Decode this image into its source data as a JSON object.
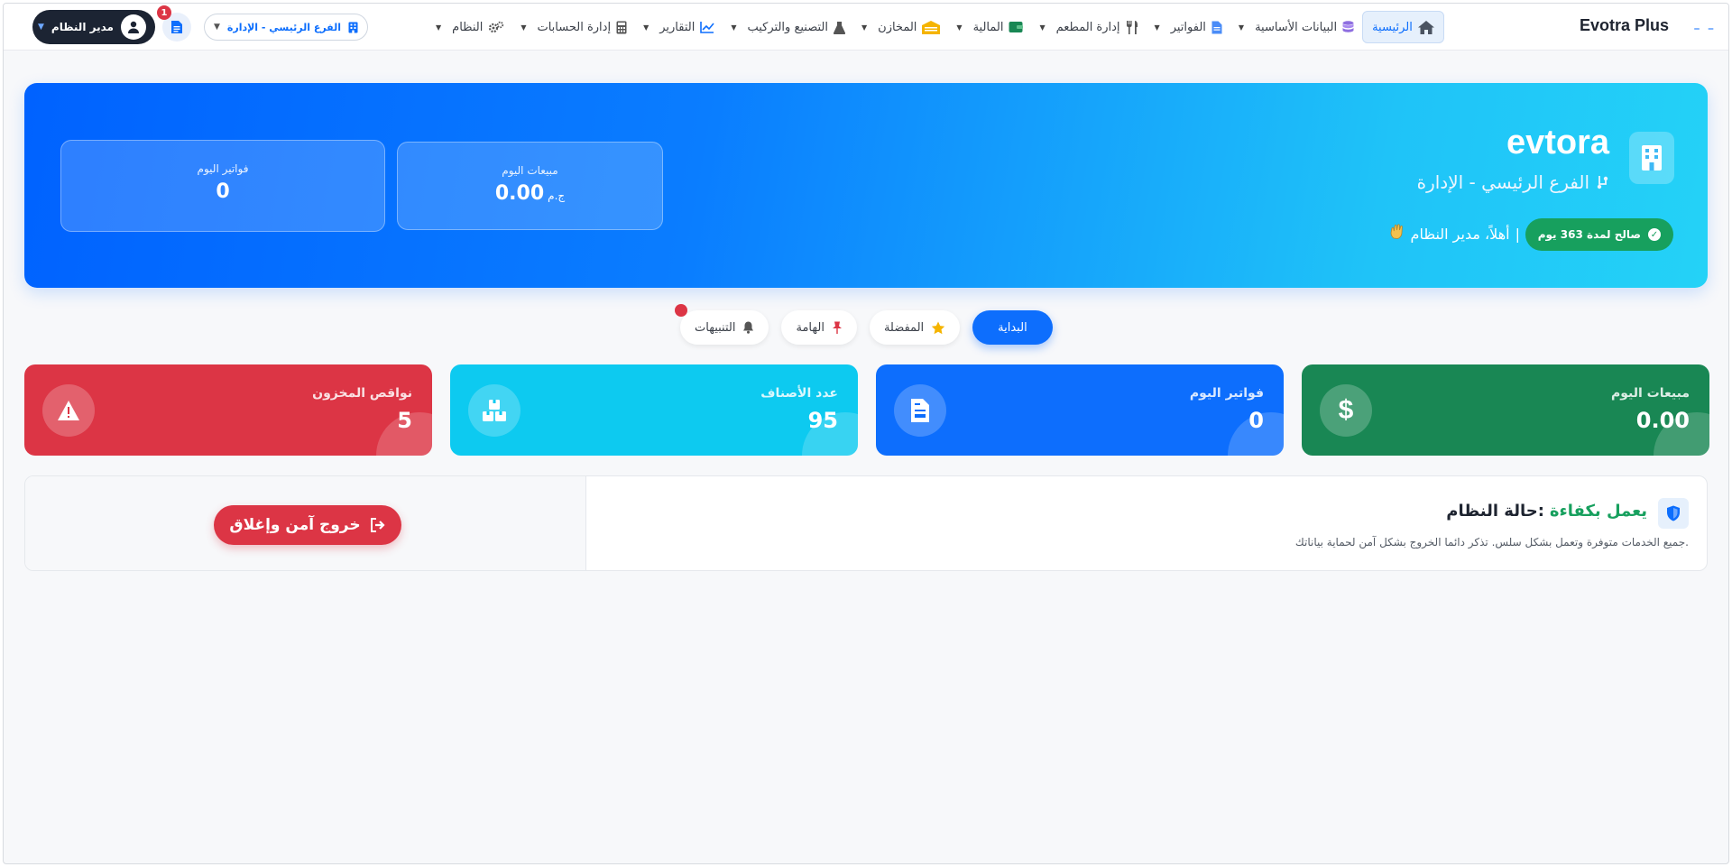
{
  "app": {
    "brand": "Evotra Plus"
  },
  "navbar": {
    "user": {
      "name": "مدير النظام"
    },
    "notifications": {
      "count": "1"
    },
    "branch_select": {
      "value": "الفرع الرئيسي - الإدارة"
    },
    "menu": [
      {
        "label": "النظام",
        "icon": "gears-icon",
        "has_dropdown": true
      },
      {
        "label": "إدارة الحسابات",
        "icon": "calculator-icon",
        "has_dropdown": true
      },
      {
        "label": "التقارير",
        "icon": "line-chart-icon",
        "has_dropdown": true
      },
      {
        "label": "التصنيع والتركيب",
        "icon": "flask-icon",
        "has_dropdown": true
      },
      {
        "label": "المخازن",
        "icon": "warehouse-icon",
        "has_dropdown": true
      },
      {
        "label": "المالية",
        "icon": "wallet-icon",
        "has_dropdown": true
      },
      {
        "label": "إدارة المطعم",
        "icon": "utensils-icon",
        "has_dropdown": true
      },
      {
        "label": "الفواتير",
        "icon": "file-icon",
        "has_dropdown": true
      },
      {
        "label": "البيانات الأساسية",
        "icon": "database-icon",
        "has_dropdown": true
      },
      {
        "label": "الرئيسية",
        "icon": "home-icon",
        "has_dropdown": false,
        "active": true
      }
    ]
  },
  "hero": {
    "title": "evtora",
    "subtitle": "الفرع الرئيسي - الإدارة",
    "validity": "صالح لمدة 363 يوم",
    "welcome": "أهلاً، مدير النظام",
    "today_sales": {
      "label": "مبيعات اليوم",
      "value": "0.00",
      "currency": "ج.م"
    },
    "today_invoices": {
      "label": "فواتير اليوم",
      "value": "0"
    }
  },
  "tabs": [
    {
      "label": "التنبيهات",
      "icon": "bell-icon",
      "has_alert": true
    },
    {
      "label": "الهامة",
      "icon": "pin-icon"
    },
    {
      "label": "المفضلة",
      "icon": "star-icon"
    },
    {
      "label": "البداية",
      "active": true
    }
  ],
  "cards": [
    {
      "label": "نواقص المخزون",
      "value": "5",
      "color": "#dc3545",
      "icon": "warning-icon"
    },
    {
      "label": "عدد الأصناف",
      "value": "95",
      "color": "#0dcaf0",
      "icon": "boxes-icon"
    },
    {
      "label": "فواتير اليوم",
      "value": "0",
      "color": "#0d6efd",
      "icon": "invoice-icon"
    },
    {
      "label": "مبيعات اليوم",
      "value": "0.00",
      "color": "#198754",
      "icon": "dollar-icon"
    }
  ],
  "status": {
    "title": "حالة النظام:",
    "state": "يعمل بكفاءة",
    "description": "جميع الخدمات متوفرة وتعمل بشكل سلس. تذكر دائما الخروج بشكل آمن لحماية بياناتك.",
    "exit_button": "خروج آمن وإغلاق"
  },
  "colors": {
    "primary": "#0d6efd",
    "success": "#198754",
    "danger": "#dc3545",
    "info": "#0dcaf0",
    "dark": "#1c2433"
  }
}
